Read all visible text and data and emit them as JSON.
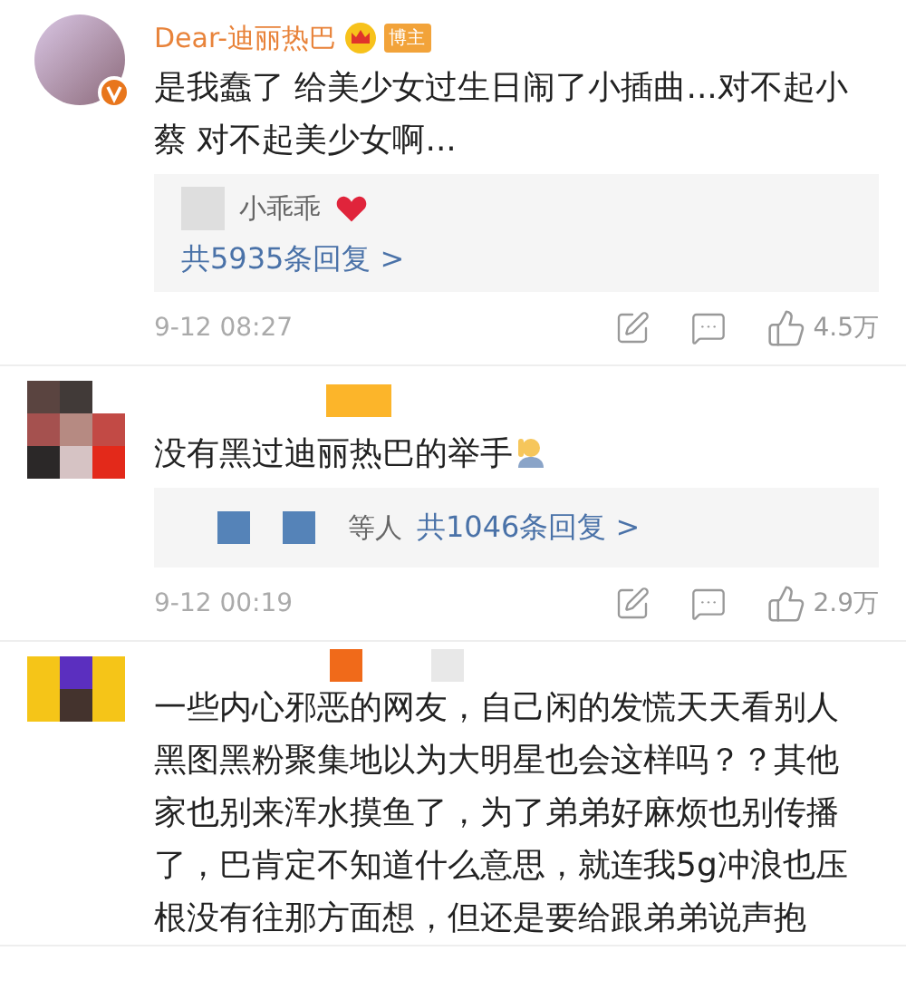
{
  "comments": [
    {
      "avatar": {
        "kind": "photo"
      },
      "verified": true,
      "name": "Dear-迪丽热巴",
      "crown": true,
      "badge": "博主",
      "text": "是我蠢了 给美少女过生日闹了小插曲...对不起小蔡 对不起美少女啊...",
      "replies": {
        "kind": "preview",
        "user": "小乖乖",
        "heart": true,
        "count": "共5935条回复 >"
      },
      "time": "9-12 08:27",
      "likes": "4.5万"
    },
    {
      "avatar": {
        "kind": "mosaic"
      },
      "text": "没有黑过迪丽热巴的举手",
      "emoji": true,
      "replies": {
        "kind": "names",
        "suffix": "等人",
        "count": "共1046条回复 >"
      },
      "time": "9-12 00:19",
      "likes": "2.9万"
    },
    {
      "avatar": {
        "kind": "mosaic"
      },
      "text": "一些内心邪恶的网友，自己闲的发慌天天看别人黑图黑粉聚集地以为大明星也会这样吗？？其他家也别来浑水摸鱼了，为了弟弟好麻烦也别传播了，巴肯定不知道什么意思，就连我5g冲浪也压根没有往那方面想，但还是要给跟弟弟说声抱"
    }
  ]
}
